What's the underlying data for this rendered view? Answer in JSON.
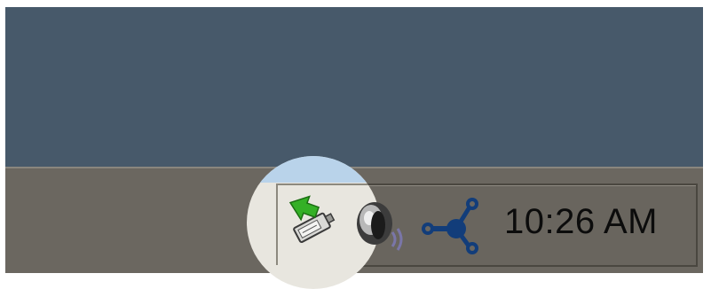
{
  "taskbar": {
    "tray": {
      "icons": [
        {
          "name": "safely-remove-hardware-icon"
        },
        {
          "name": "volume-icon"
        },
        {
          "name": "network-icon"
        }
      ],
      "clock": "10:26 AM"
    }
  },
  "colors": {
    "desktop": "#47596a",
    "taskbar": "#6b6760",
    "magnifier": "#e8e6df",
    "clock_text": "#0c0c0c",
    "network_icon": "#123d7a",
    "usb_arrow": "#34b026"
  }
}
